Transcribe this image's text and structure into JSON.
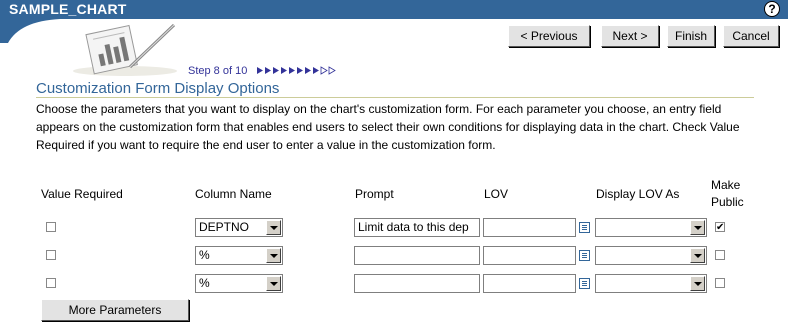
{
  "window": {
    "title": "SAMPLE_CHART",
    "help": "?"
  },
  "nav": {
    "previous": "< Previous",
    "next": "Next >",
    "finish": "Finish",
    "cancel": "Cancel"
  },
  "step": {
    "text": "Step 8 of 10",
    "current": 8,
    "total": 10
  },
  "section": {
    "title": "Customization Form Display Options",
    "description": "Choose the parameters that you want to display on the chart's customization form. For each parameter you choose, an entry field appears on the customization form that enables end users to select their own conditions for displaying data in the chart. Check Value Required if you want to require the end user to enter a value in the customization form."
  },
  "table": {
    "headers": {
      "value_required": "Value Required",
      "column_name": "Column Name",
      "prompt": "Prompt",
      "lov": "LOV",
      "display_lov_as": "Display LOV As",
      "make_public_1": "Make",
      "make_public_2": "Public"
    },
    "rows": [
      {
        "value_required": false,
        "column": "DEPTNO",
        "prompt": "Limit data to this dep",
        "lov": "",
        "display_lov_as": "",
        "make_public": true
      },
      {
        "value_required": false,
        "column": "%",
        "prompt": "",
        "lov": "",
        "display_lov_as": "",
        "make_public": false
      },
      {
        "value_required": false,
        "column": "%",
        "prompt": "",
        "lov": "",
        "display_lov_as": "",
        "make_public": false
      }
    ]
  },
  "more_parameters": "More Parameters",
  "colors": {
    "titlebar": "#336699",
    "heading": "#336699",
    "step_text": "#333399"
  },
  "icons": {
    "help": "help-icon",
    "header_graphic": "chart-pen-icon",
    "lov": "lov-list-icon"
  }
}
